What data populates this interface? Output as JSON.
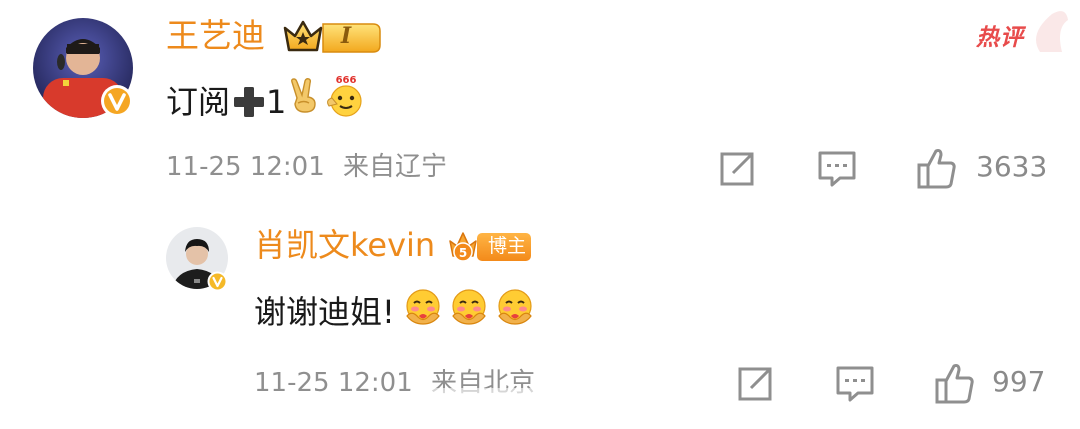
{
  "comment": {
    "author": "王艺迪",
    "level_badge": "I",
    "hot_tag": "热评",
    "text_prefix": "订阅",
    "text_suffix": "1",
    "time": "11-25 12:01",
    "location": "来自辽宁",
    "likes": "3633"
  },
  "reply": {
    "author": "肖凯文kevin",
    "badge": "博主",
    "text": "谢谢迪姐!",
    "time": "11-25 12:01",
    "location": "来自北京",
    "likes": "997"
  },
  "colors": {
    "name": "#ed8a1c",
    "hot": "#e84b4b",
    "meta": "#8f8f8f",
    "badge_orange": "#f5a623"
  },
  "icons": [
    "share-icon",
    "comment-icon",
    "like-icon",
    "verified-icon",
    "crown-icon",
    "plus-icon",
    "victory-emoji",
    "666-emoji",
    "hug-emoji"
  ]
}
